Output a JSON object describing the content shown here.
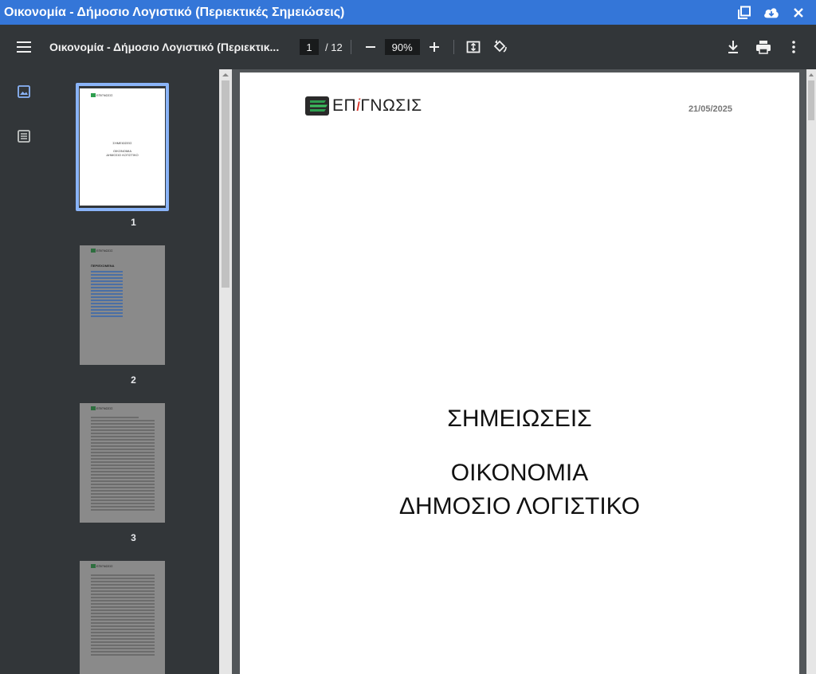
{
  "window": {
    "title": "Οικονομία - Δήμοσιο Λογιστικό (Περιεκτικές Σημειώσεις)",
    "icons": [
      "restore-window-icon",
      "cloud-download-icon",
      "close-icon"
    ]
  },
  "toolbar": {
    "doc_title": "Οικονομία - Δήμοσιο Λογιστικό (Περιεκτικ...",
    "current_page": "1",
    "total_pages": "/ 12",
    "zoom": "90%"
  },
  "thumbnails": {
    "labels": [
      "1",
      "2",
      "3"
    ],
    "page1_text": [
      "ΣΗΜΕΙΩΣΕΙΣ",
      "ΟΙΚΟΝΟΜΙΑ",
      "ΔΗΜΟΣΙΟ ΛΟΓΙΣΤΙΚΟ"
    ],
    "page2_heading": "ΠΕΡΙΕΧΟΜΕΝΑ",
    "logo_small": "ΕΠiΓΝΩΣΙΣ"
  },
  "document": {
    "logo_prefix": "ΕΠ",
    "logo_i": "i",
    "logo_suffix": "ΓΝΩΣΙΣ",
    "date": "21/05/2025",
    "heading1": "ΣΗΜΕΙΩΣΕΙΣ",
    "heading2": "ΟΙΚΟΝΟΜΙΑ",
    "heading3": "ΔΗΜΟΣΙΟ ΛΟΓΙΣΤΙΚΟ"
  },
  "colors": {
    "titlebar": "#3476d8",
    "toolbar": "#323639",
    "selection": "#8ab4f8",
    "logo_green": "#2e9e4f"
  }
}
